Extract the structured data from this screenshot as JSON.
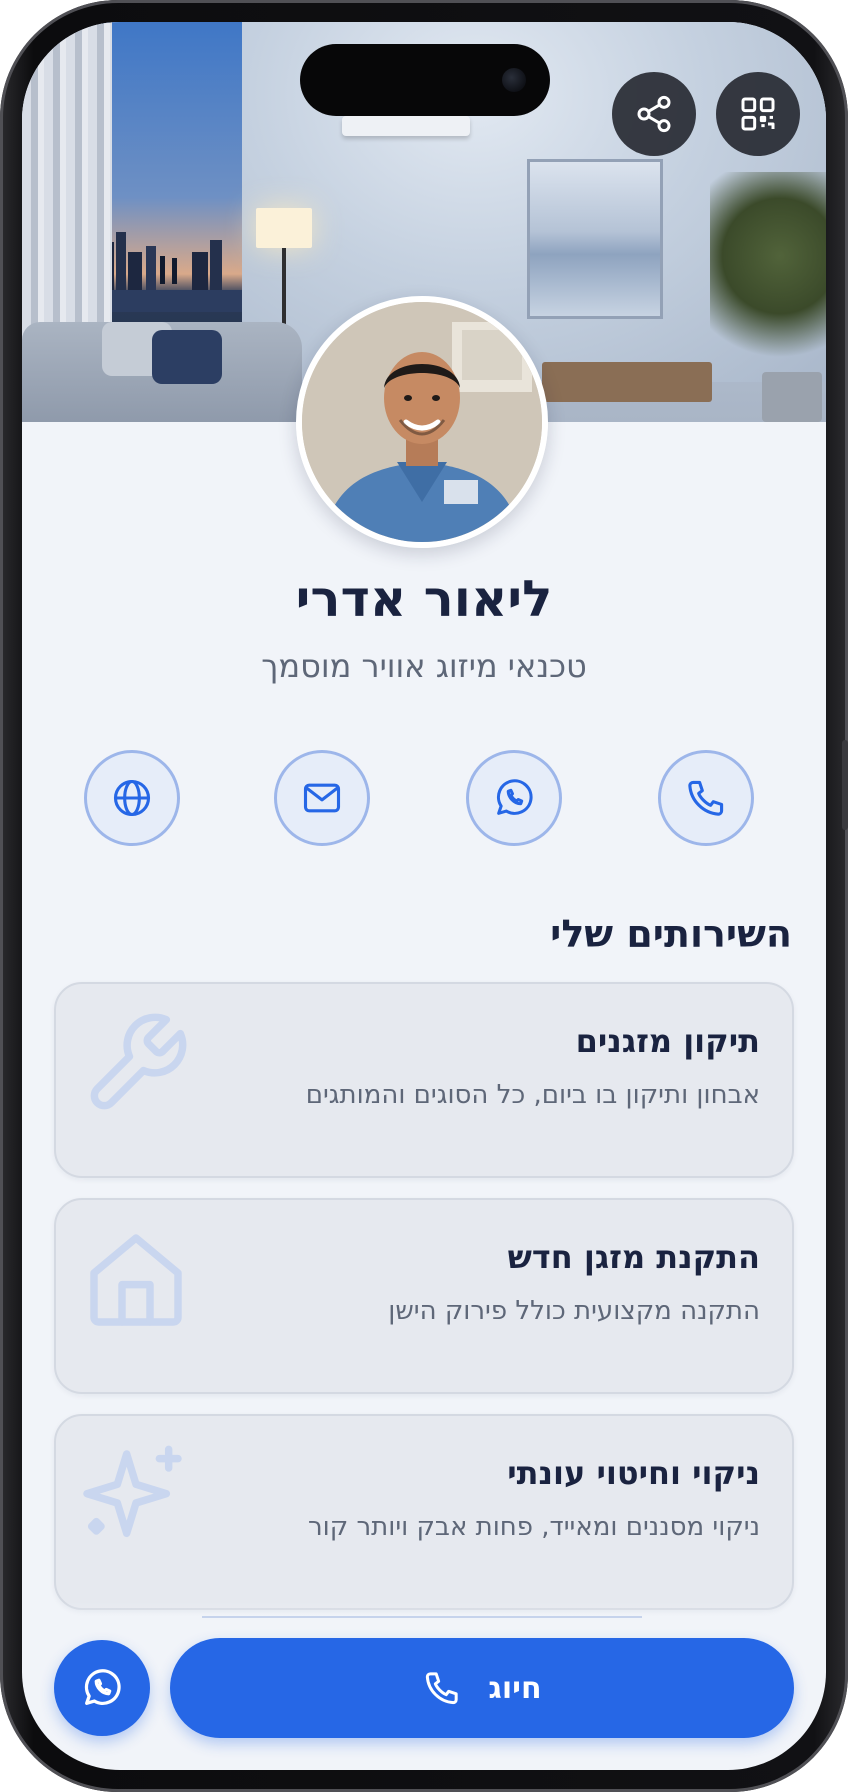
{
  "profile": {
    "name": "ליאור אדרי",
    "title": "טכנאי מיזוג אוויר מוסמך"
  },
  "header_actions": [
    {
      "icon": "share-icon"
    },
    {
      "icon": "qr-code-icon"
    }
  ],
  "contact_buttons": [
    {
      "icon": "phone-icon"
    },
    {
      "icon": "whatsapp-icon"
    },
    {
      "icon": "mail-icon"
    },
    {
      "icon": "globe-icon"
    }
  ],
  "services": {
    "heading": "השירותים שלי",
    "items": [
      {
        "title": "תיקון מזגנים",
        "description": "אבחון ותיקון בו ביום, כל הסוגים והמותגים",
        "icon": "wrench-icon"
      },
      {
        "title": "התקנת מזגן חדש",
        "description": "התקנה מקצועית כולל פירוק הישן",
        "icon": "home-icon"
      },
      {
        "title": "ניקוי וחיטוי עונתי",
        "description": "ניקוי מסננים ומאייד, פחות אבק ויותר קור",
        "icon": "sparkle-icon"
      }
    ]
  },
  "bottom_bar": {
    "call_label": "חיוג",
    "call_icon": "phone-icon",
    "whatsapp_icon": "whatsapp-icon"
  },
  "colors": {
    "primary": "#2667e6",
    "heading": "#1a2340",
    "muted_text": "#5e6778",
    "contact_ring": "#9db6ea",
    "card_bg": "#e6e9ef",
    "page_bg": "#f1f4f9"
  }
}
